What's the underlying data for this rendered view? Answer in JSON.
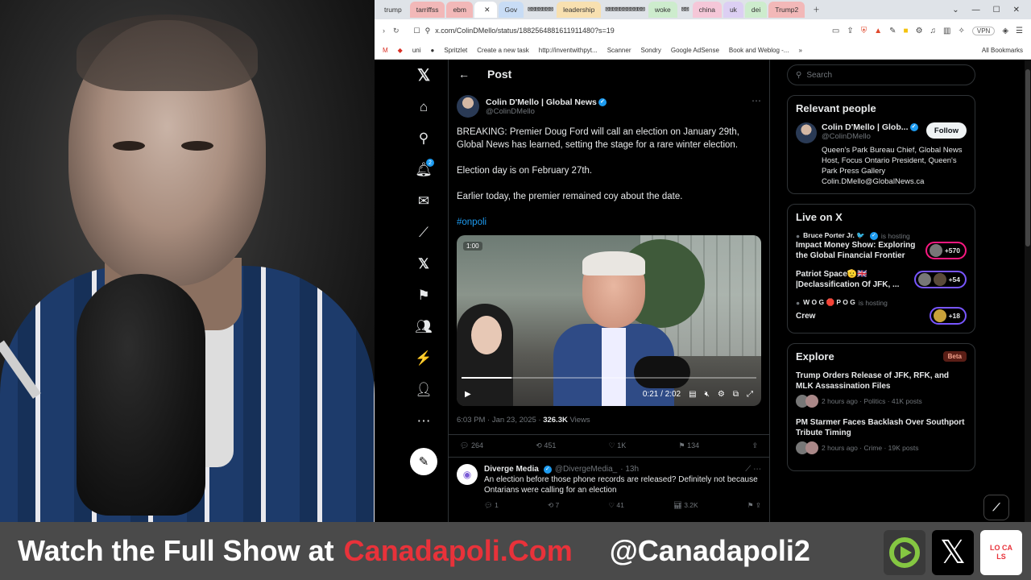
{
  "browser": {
    "tabs": [
      {
        "label": "trump",
        "color": "#dfe3e8"
      },
      {
        "label": "tarriffss",
        "color": "#f2b8b8"
      },
      {
        "label": "ebm",
        "color": "#f2b8b8"
      },
      {
        "label": "Gov",
        "color": "#c8dcf5"
      },
      {
        "label": "leadership",
        "color": "#f8e0b0"
      },
      {
        "label": "woke",
        "color": "#cdeccd"
      },
      {
        "label": "china",
        "color": "#f5c7d8"
      },
      {
        "label": "uk",
        "color": "#dccff3"
      },
      {
        "label": "dei",
        "color": "#cdeccd"
      },
      {
        "label": "Trump2",
        "color": "#f2b8b8"
      }
    ],
    "url": "x.com/ColinDMello/status/1882564881611911480?s=19",
    "vpn_label": "VPN",
    "bookmarks": [
      "uni",
      "Spritzlet",
      "Create a new task",
      "http://inventwithpyt...",
      "Scanner",
      "Sondry",
      "Google AdSense",
      "Book and Weblog -..."
    ],
    "all_bookmarks": "All Bookmarks"
  },
  "x": {
    "nav_icons": [
      "x-logo-icon",
      "home-icon",
      "search-icon",
      "notifications-icon",
      "messages-icon",
      "grok-icon",
      "premium-icon",
      "bookmarks-icon",
      "communities-icon",
      "verified-orgs-icon",
      "profile-icon",
      "more-icon"
    ],
    "notification_count": "2",
    "post_header": "Post",
    "post": {
      "author_name": "Colin D'Mello | Global News",
      "author_handle": "@ColinDMello",
      "paragraphs": [
        "BREAKING: Premier Doug Ford will call an election on January 29th, Global News has learned, setting the stage for a rare winter election.",
        "Election day is on February 27th.",
        "Earlier today, the premier remained coy about the date."
      ],
      "hashtag": "#onpoli",
      "video_badge": "1:00",
      "video_time": "0:21 / 2:02",
      "video_progress": 0.17,
      "timestamp": "6:03 PM · Jan 23, 2025 · ",
      "views_count": "326.3K",
      "views_label": " Views",
      "replies": "264",
      "reposts": "451",
      "likes": "1K",
      "bookmarks": "134"
    },
    "reply": {
      "name": "Diverge Media",
      "handle": "@DivergeMedia_",
      "time": "· 13h",
      "text": "An election before those phone records are released? Definitely not because Ontarians were calling for an election",
      "replies": "1",
      "reposts": "7",
      "likes": "41",
      "views": "3.2K"
    },
    "search_placeholder": "Search",
    "relevant": {
      "title": "Relevant people",
      "name": "Colin D'Mello | Glob...",
      "handle": "@ColinDMello",
      "follow": "Follow",
      "bio": "Queen's Park Bureau Chief, Global News Host, Focus Ontario President, Queen's Park Press Gallery Colin.DMello@GlobalNews.ca"
    },
    "live": {
      "title": "Live on X",
      "items": [
        {
          "host": "Bruce Porter Jr. 🐦",
          "status": "is hosting",
          "title": "Impact Money Show: Exploring the Global Financial Frontier",
          "count": "+570",
          "ring": "pink"
        },
        {
          "host": "",
          "status": "",
          "title": "Patriot Space🫡🇬🇧 |Declassification Of JFK, ...",
          "count": "+54",
          "ring": "purple"
        },
        {
          "host": "W O G 🛑 P O G",
          "status": "is hosting",
          "title": "Crew",
          "count": "+18",
          "ring": "purple"
        }
      ]
    },
    "explore": {
      "title": "Explore",
      "beta": "Beta",
      "items": [
        {
          "title": "Trump Orders Release of JFK, RFK, and MLK Assassination Files",
          "meta": "2 hours ago · Politics · 41K posts"
        },
        {
          "title": "PM Starmer Faces Backlash Over Southport Tribute Timing",
          "meta": "2 hours ago · Crime · 19K posts"
        }
      ]
    },
    "grok_label": "Grok"
  },
  "banner": {
    "watch": "Watch the Full Show at",
    "site": "Canadapoli.Com",
    "handle": "@Canadapoli2",
    "locals_logo": "LO CA LS"
  }
}
